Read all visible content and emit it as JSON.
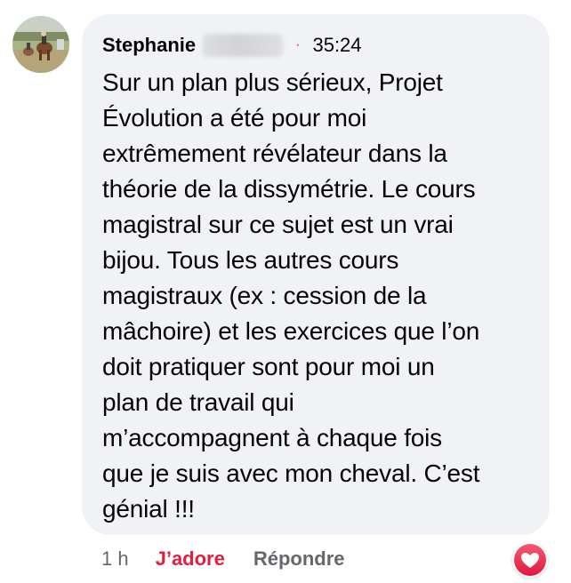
{
  "comment": {
    "author": "Stephanie",
    "author_suffix_hidden": true,
    "separator": "·",
    "timestamp": "35:24",
    "text": "Sur un plan plus sérieux, Projet\nÉvolution a été pour moi\nextrêmement révélateur dans la\nthéorie de la dissymétrie. Le cours\nmagistral sur ce sujet est un vrai\nbijou. Tous les autres cours\nmagistraux (ex : cession de la\nmâchoire) et les exercices que l’on\ndoit pratiquer sont pour moi un\nplan de travail qui\nm’accompagnent à chaque fois\nque je suis avec mon cheval. C’est\ngénial !!!"
  },
  "actions": {
    "age": "1 h",
    "love_label": "J’adore",
    "reply_label": "Répondre"
  },
  "reaction": {
    "icon": "heart-icon",
    "color": "#f33e58"
  },
  "colors": {
    "bubble": "#f0f2f5",
    "love": "#e41e3f",
    "muted": "#65676b",
    "text": "#050505"
  }
}
